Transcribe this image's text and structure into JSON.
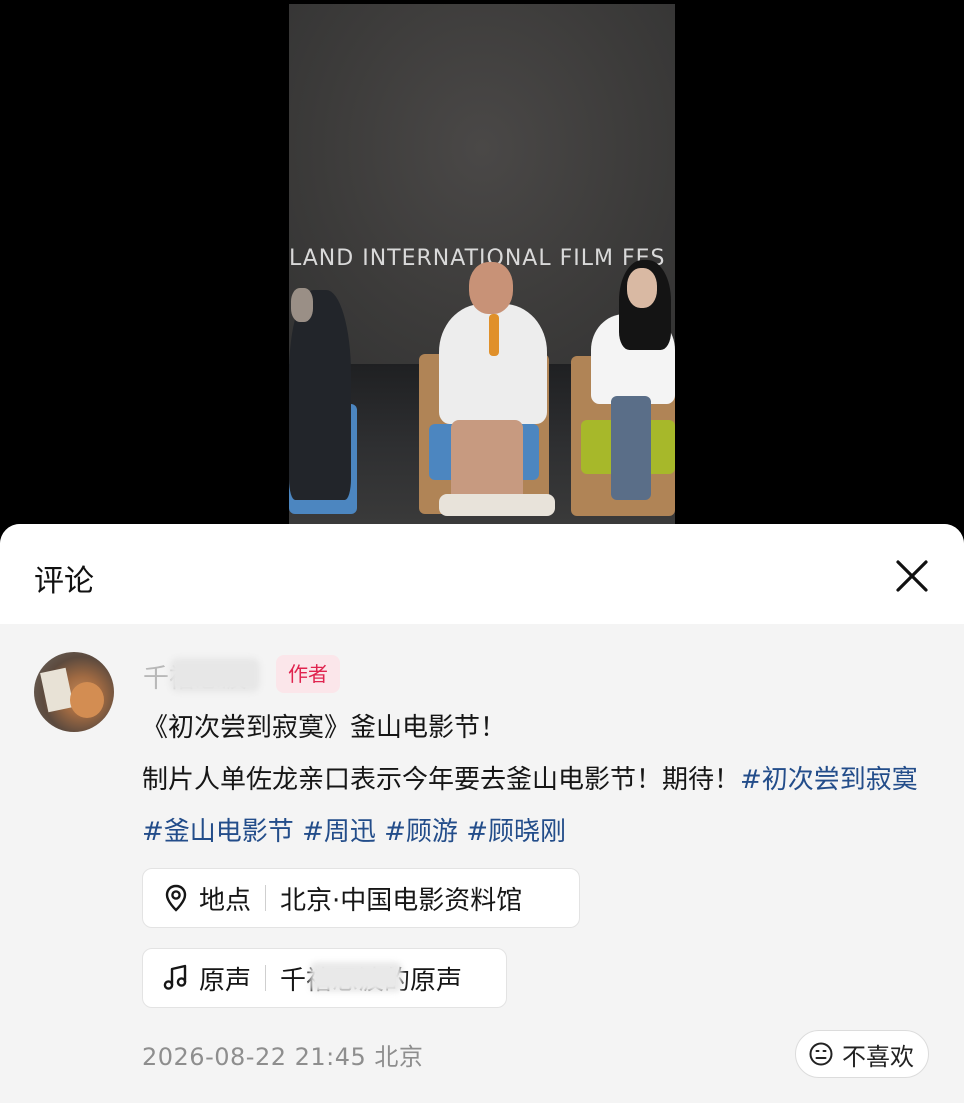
{
  "video": {
    "overlay_text": "LAND INTERNATIONAL FILM FES"
  },
  "panel": {
    "title": "评论",
    "close_icon": "close-icon"
  },
  "comment": {
    "username": "千禧思波",
    "author_badge": "作者",
    "line1": "《初次尝到寂寞》釜山电影节！",
    "line2_prefix": "制片人单佐龙亲口表示今年要去釜山电影节！期待！",
    "hashtags": [
      "#初次尝到寂寞",
      "#釜山电影节",
      "#周迅",
      "#顾游",
      "#顾晓刚"
    ],
    "location": {
      "label": "地点",
      "value": "北京·中国电影资料馆",
      "icon": "location-pin-icon"
    },
    "sound": {
      "label": "原声",
      "value": "千禧思波的原声",
      "icon": "music-note-icon"
    },
    "timestamp": "2026-08-22 21:45",
    "region": "北京",
    "dislike_label": "不喜欢"
  },
  "colors": {
    "hashtag": "#234d8a",
    "author_badge_text": "#e0244f",
    "author_badge_bg": "#fbe6ea",
    "panel_body_bg": "#f4f4f4"
  }
}
